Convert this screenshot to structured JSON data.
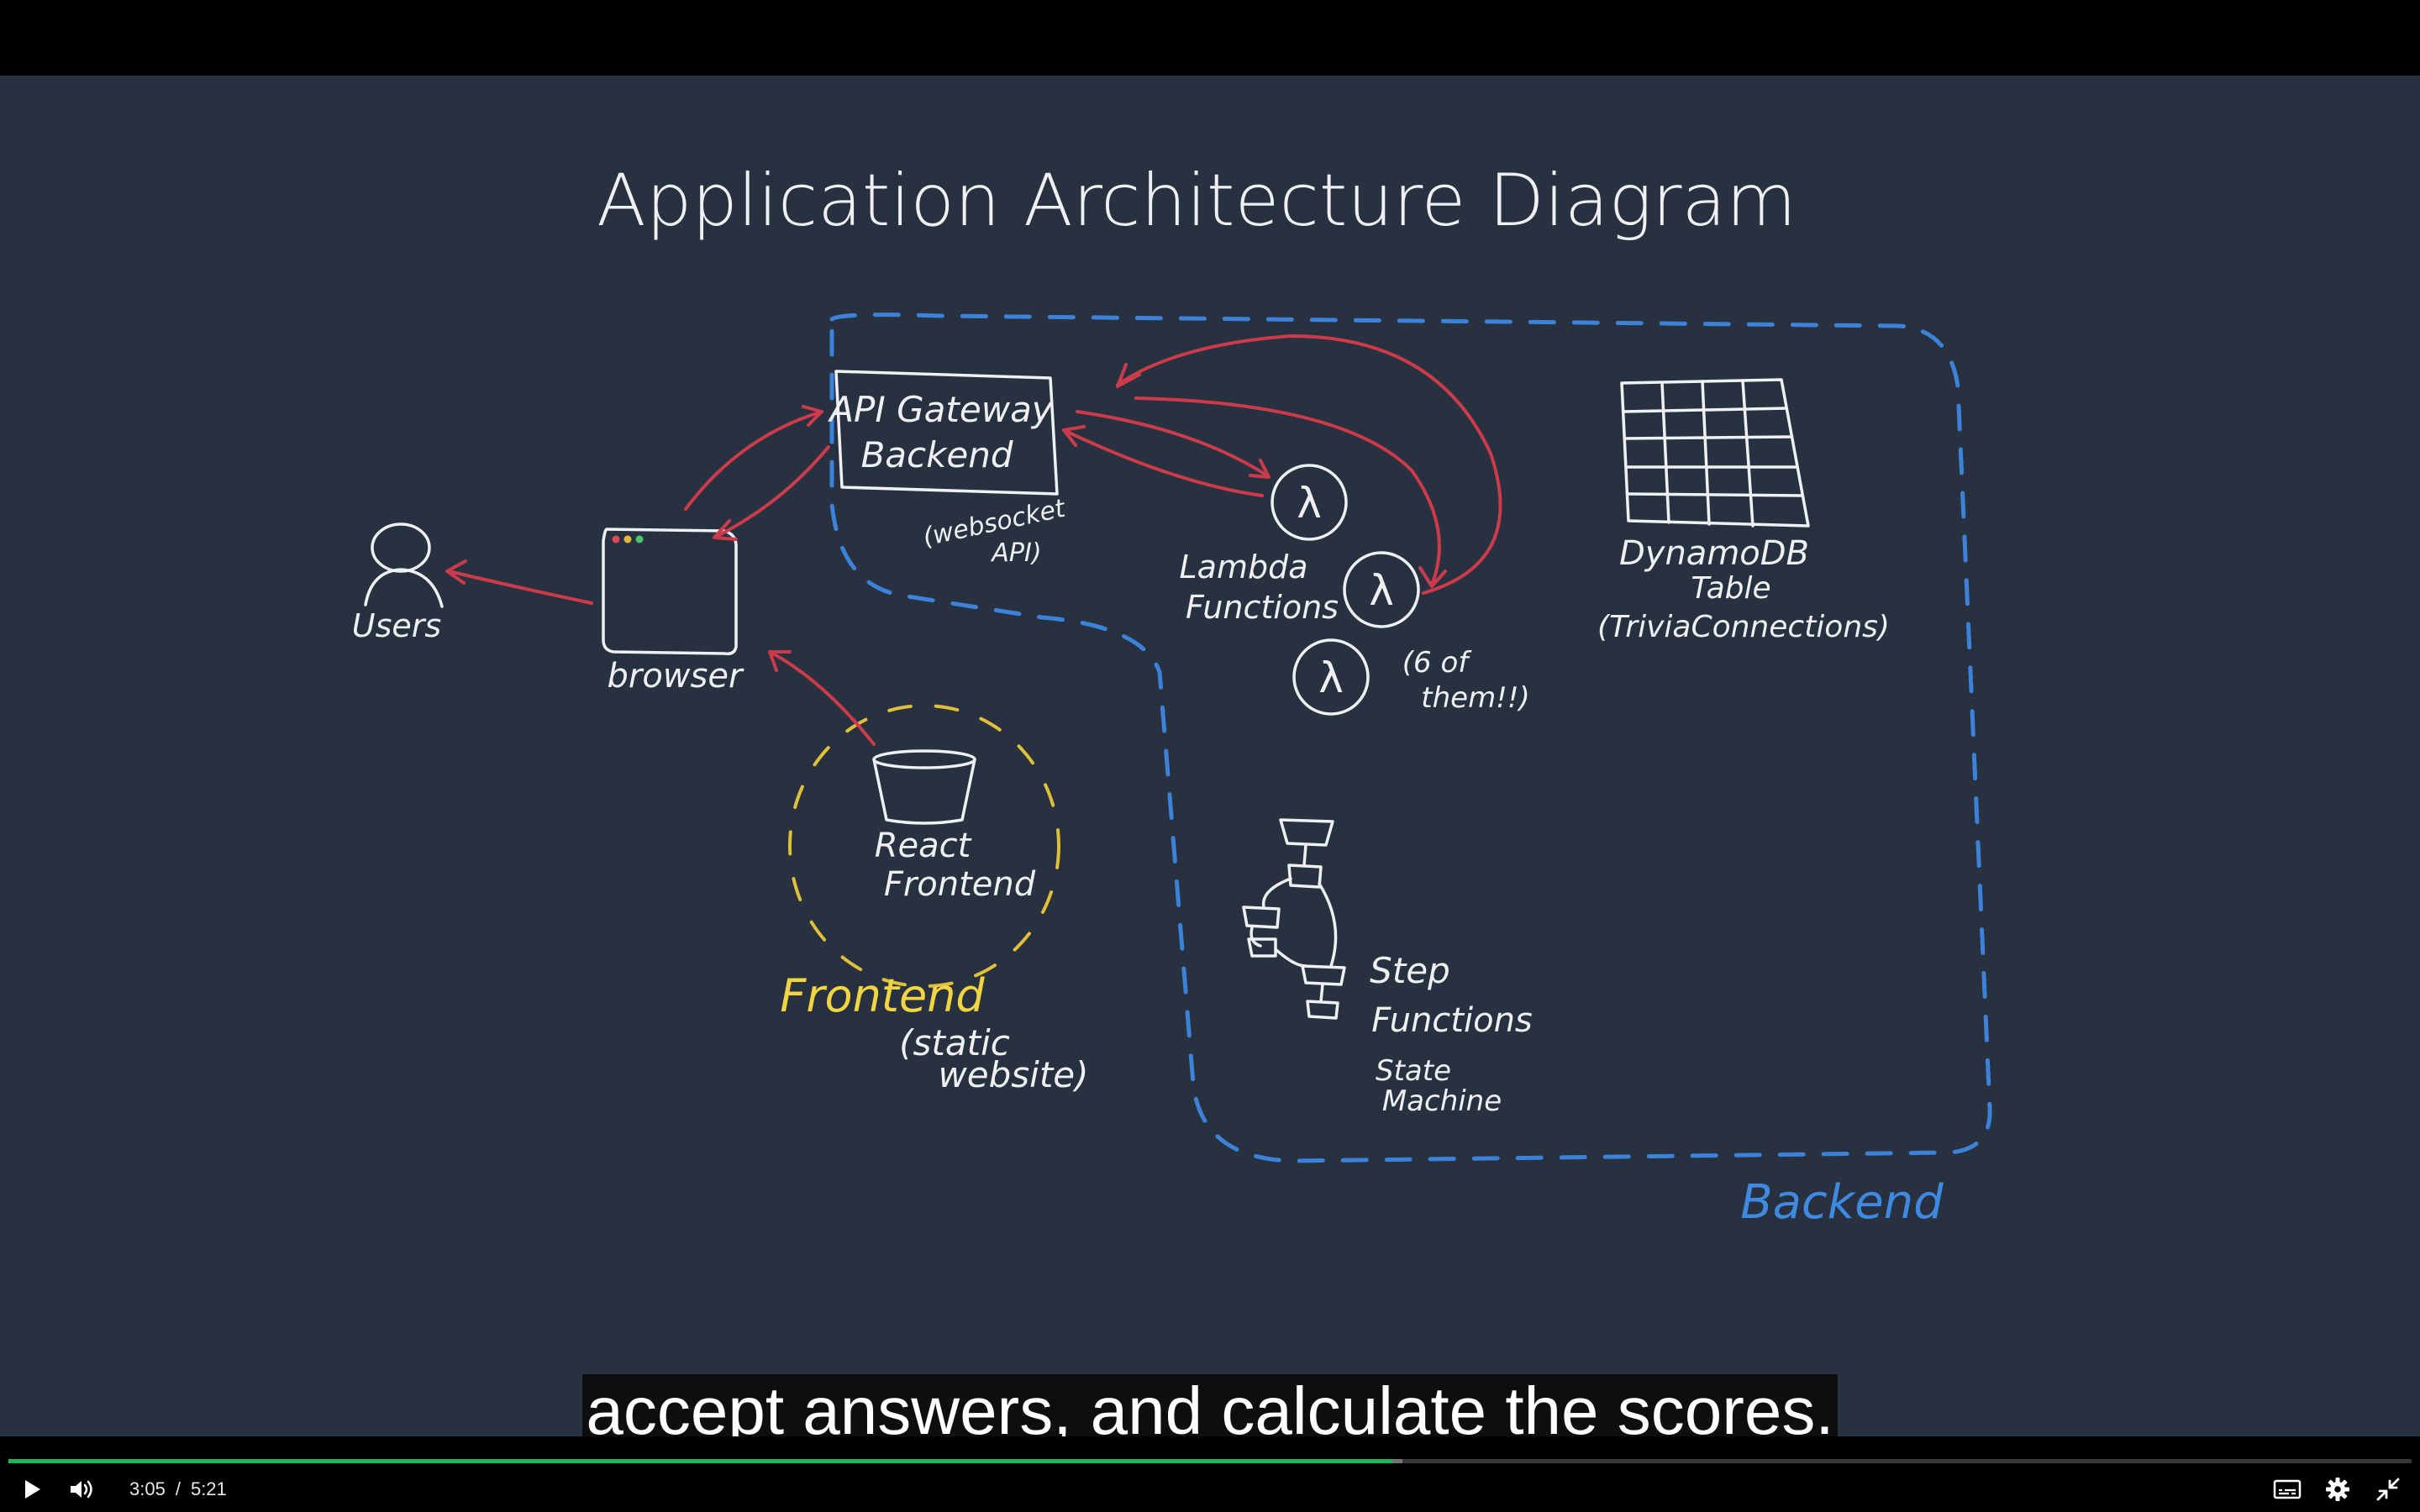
{
  "whiteboard": {
    "title": "Application Architecture Diagram",
    "labels": {
      "users": "Users",
      "browser": "browser",
      "api_gateway_line1": "API Gateway",
      "api_gateway_line2": "Backend",
      "api_note_line1": "(websocket",
      "api_note_line2": "API)",
      "lambda_line1": "Lambda",
      "lambda_line2": "Functions",
      "lambda_note_line1": "(6 of",
      "lambda_note_line2": "them!!)",
      "dynamo_line1": "DynamoDB",
      "dynamo_line2": "Table",
      "dynamo_line3": "(TriviaConnections)",
      "react_line1": "React",
      "react_line2": "Frontend",
      "frontend_line1": "Frontend",
      "frontend_line2": "(static",
      "frontend_line3": "website)",
      "step_line1": "Step",
      "step_line2": "Functions",
      "step_line3": "State",
      "step_line4": "Machine",
      "backend": "Backend",
      "lambda_symbol": "λ"
    },
    "colors": {
      "background": "#273140",
      "ink_white": "#eef0f3",
      "arrow_red": "#cc3b4c",
      "frontend_yellow": "#f2d543",
      "backend_blue": "#3c82d8"
    }
  },
  "caption": {
    "text": "accept answers, and calculate the scores."
  },
  "player": {
    "current_time": "3:05",
    "time_separator": "/",
    "duration": "5:21",
    "progress_fraction": 0.576,
    "buffered_fraction": 0.58,
    "progress_color": "#1fb35a",
    "icons": {
      "play": "play-icon",
      "volume": "volume-icon",
      "captions": "captions-icon",
      "settings": "gear-icon",
      "exit_fullscreen": "exit-fullscreen-icon"
    }
  }
}
